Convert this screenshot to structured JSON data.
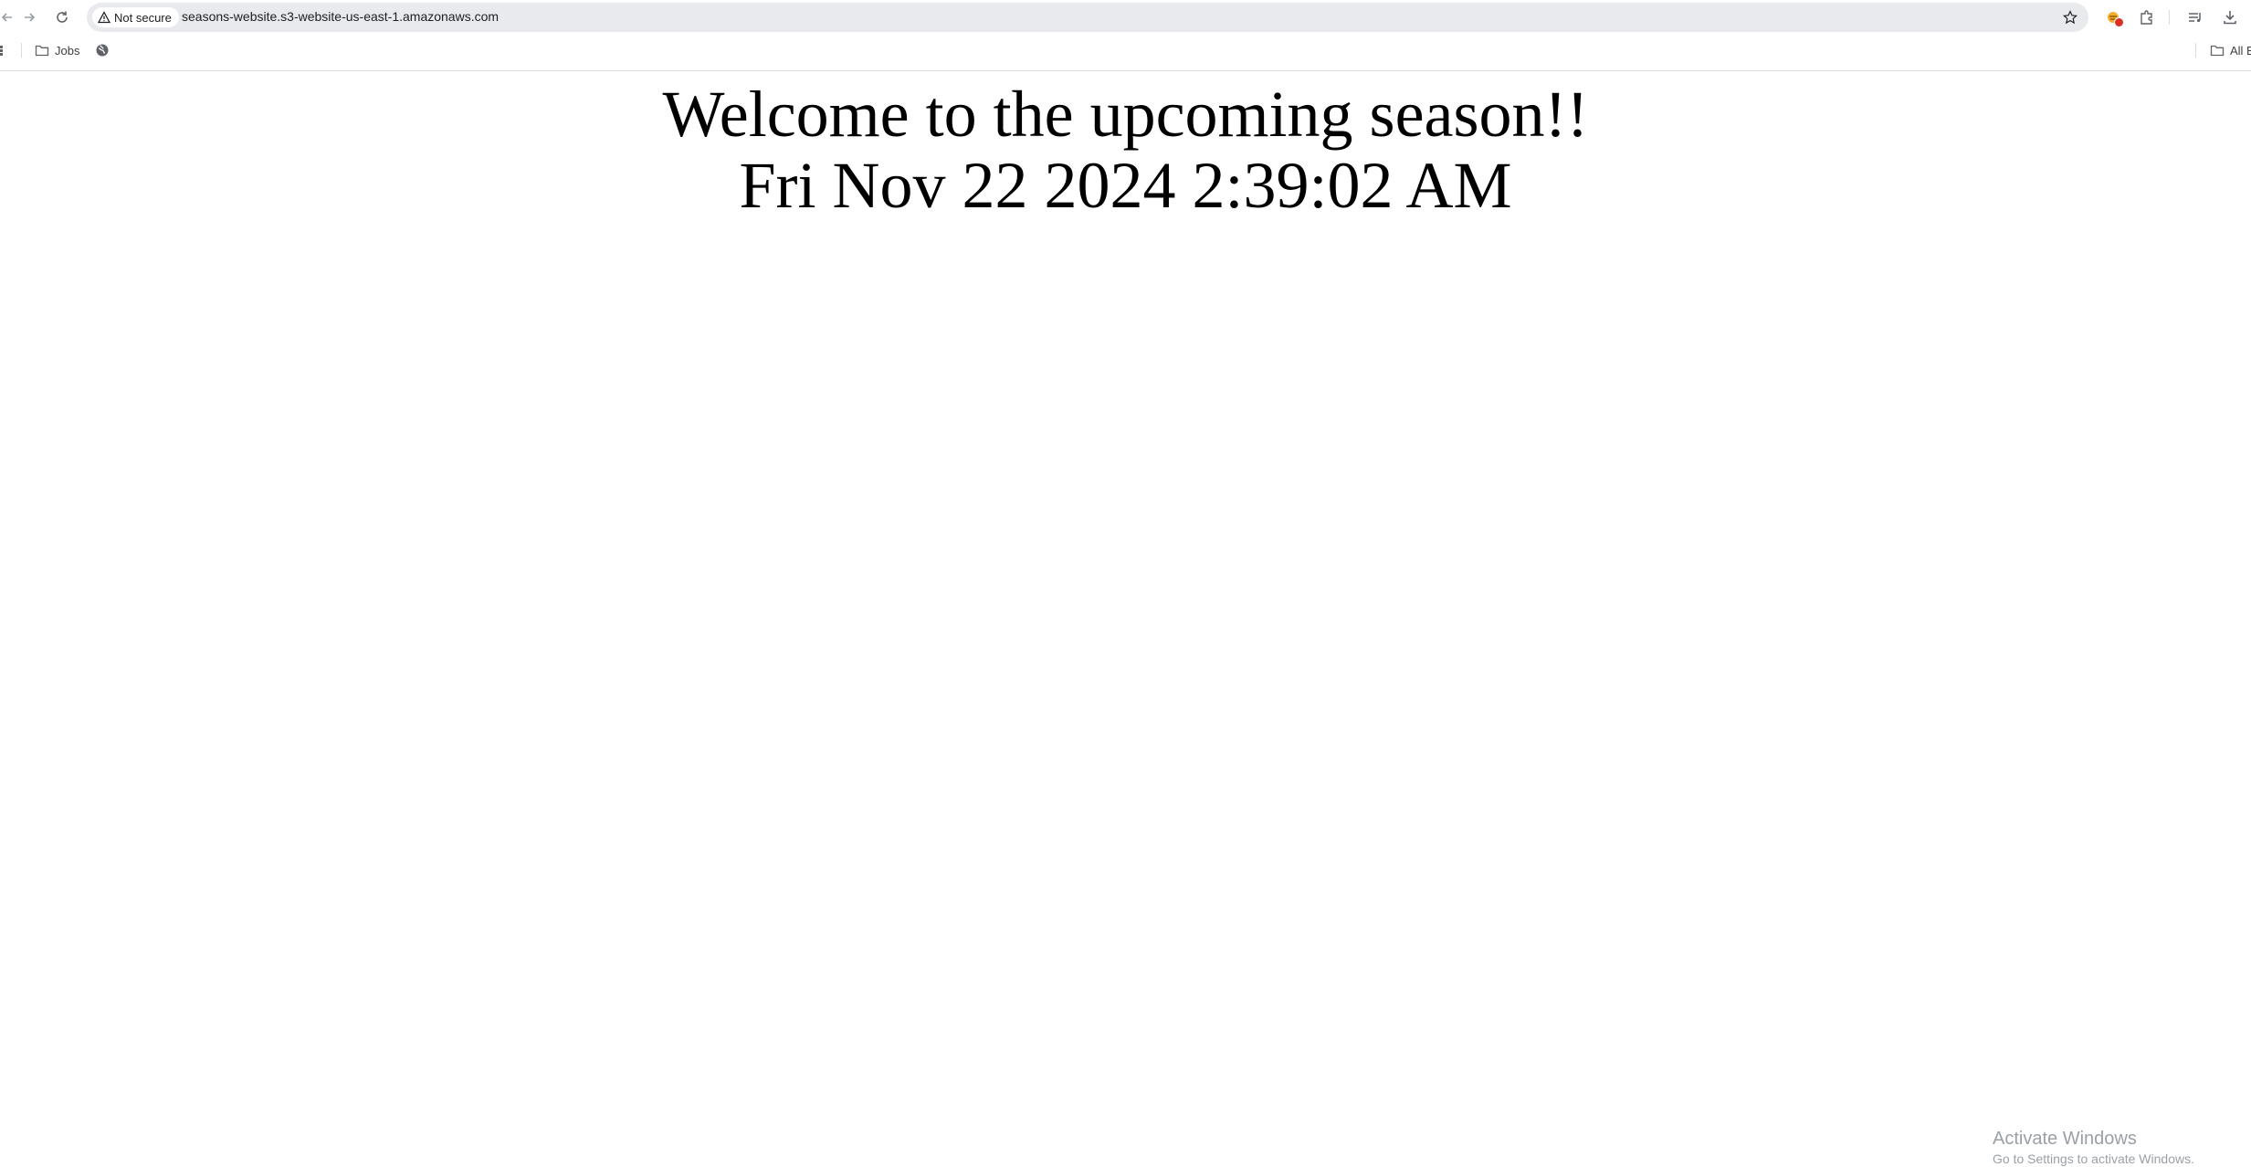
{
  "browser": {
    "security_label": "Not secure",
    "url": "seasons-website.s3-website-us-east-1.amazonaws.com",
    "icons": {
      "back": "back-arrow-icon",
      "forward": "forward-arrow-icon",
      "reload": "reload-icon",
      "security": "warning-triangle-icon",
      "bookmark": "star-icon",
      "extension": "extension-icon",
      "extensions_menu": "puzzle-piece-icon",
      "media": "media-controls-icon",
      "downloads": "download-icon"
    }
  },
  "bookmarks_bar": {
    "items": [
      {
        "label": "Jobs",
        "icon": "folder-icon"
      },
      {
        "label": "",
        "icon": "globe-icon"
      }
    ],
    "all_bookmarks_label": "All B"
  },
  "page": {
    "heading": "Welcome to the upcoming season!!",
    "datetime": "Fri Nov 22 2024 2:39:02 AM"
  },
  "watermark": {
    "title": "Activate Windows",
    "subtitle": "Go to Settings to activate Windows."
  }
}
